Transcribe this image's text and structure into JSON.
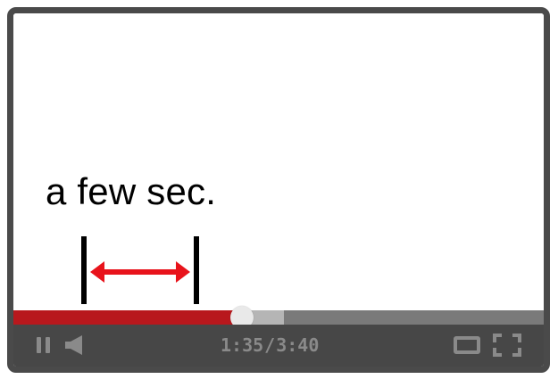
{
  "annotation": {
    "text": "a few sec."
  },
  "player": {
    "time_current": "1:35",
    "time_separator": "/",
    "time_total": "3:40",
    "progress_played_fraction": 0.4318,
    "progress_buffered_fraction": 0.51
  },
  "icons": {
    "pause": "pause-icon",
    "volume": "volume-icon",
    "theater": "theater-mode-icon",
    "fullscreen": "fullscreen-icon"
  },
  "colors": {
    "frame": "#4a4a4a",
    "played": "#b8181d",
    "buffer": "#b5b5b5",
    "track": "#7a7a7a",
    "controls_bg": "#474747",
    "controls_fg": "#8a8a8a",
    "arrow": "#e8131b"
  }
}
